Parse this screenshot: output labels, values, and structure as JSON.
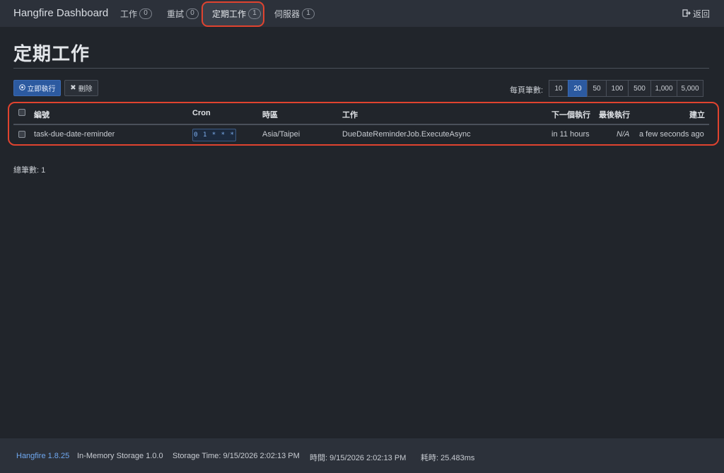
{
  "navbar": {
    "brand": "Hangfire Dashboard",
    "items": [
      {
        "label": "工作",
        "count": "0"
      },
      {
        "label": "重試",
        "count": "0"
      },
      {
        "label": "定期工作",
        "count": "1"
      },
      {
        "label": "伺服器",
        "count": "1"
      }
    ],
    "back_label": "返回"
  },
  "page": {
    "title": "定期工作"
  },
  "actions": {
    "trigger_label": "立即執行",
    "delete_label": "刪除"
  },
  "pagesize": {
    "label": "每頁筆數:",
    "options": [
      "10",
      "20",
      "50",
      "100",
      "500",
      "1,000",
      "5,000"
    ],
    "selected": "20"
  },
  "table": {
    "headers": {
      "id": "編號",
      "cron": "Cron",
      "timezone": "時區",
      "job": "工作",
      "next": "下一個執行",
      "last": "最後執行",
      "created": "建立"
    },
    "rows": [
      {
        "id": "task-due-date-reminder",
        "cron": "0 1 * * *",
        "timezone": "Asia/Taipei",
        "job": "DueDateReminderJob.ExecuteAsync",
        "next": "in 11 hours",
        "last": "N/A",
        "created": "a few seconds ago"
      }
    ]
  },
  "total_label": "總筆數: 1",
  "footer": {
    "version": "Hangfire 1.8.25",
    "storage": "In-Memory Storage 1.0.0",
    "storage_time": "Storage Time: 9/15/2026 2:02:13 PM",
    "time": "時間:  9/15/2026 2:02:13 PM",
    "elapsed": "耗時:  25.483ms"
  },
  "colors": {
    "accent": "#2c5aa0",
    "highlight": "#e0432f",
    "link": "#6fa8f0"
  }
}
